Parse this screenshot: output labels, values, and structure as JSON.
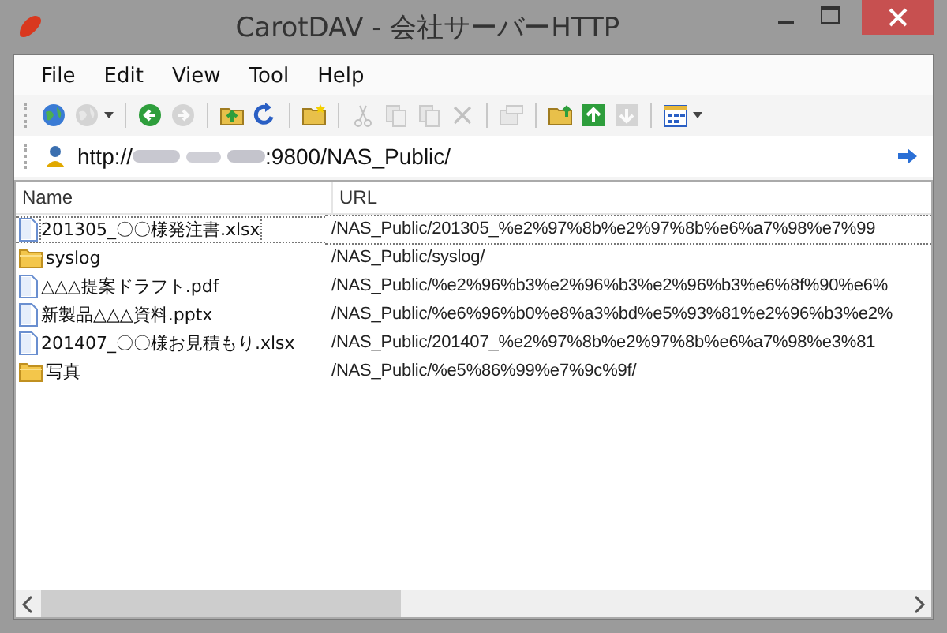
{
  "window": {
    "title": "CarotDAV - 会社サーバーHTTP"
  },
  "menu": [
    "File",
    "Edit",
    "View",
    "Tool",
    "Help"
  ],
  "toolbar": [
    {
      "disabled": false
    },
    {
      "disabled": true
    },
    {
      "disabled": false
    },
    {
      "disabled": true
    },
    {
      "disabled": false
    },
    {
      "disabled": false
    },
    {
      "disabled": false
    },
    {
      "disabled": true
    },
    {
      "disabled": true
    },
    {
      "disabled": true
    },
    {
      "disabled": true
    },
    {
      "disabled": true
    },
    {
      "disabled": false
    },
    {
      "disabled": false
    },
    {
      "disabled": true
    },
    {
      "disabled": false
    }
  ],
  "address": {
    "prefix": "http://",
    "suffix": ":9800/NAS_Public/"
  },
  "table": {
    "columns": [
      "Name",
      "URL"
    ],
    "rows": [
      {
        "kind": "file",
        "name": "201305_〇〇様発注書.xlsx",
        "url": "/NAS_Public/201305_%e2%97%8b%e2%97%8b%e6%a7%98%e7%99",
        "selected": true
      },
      {
        "kind": "folder",
        "name": "syslog",
        "url": "/NAS_Public/syslog/",
        "selected": false
      },
      {
        "kind": "file",
        "name": "△△△提案ドラフト.pdf",
        "url": "/NAS_Public/%e2%96%b3%e2%96%b3%e2%96%b3%e6%8f%90%e6%",
        "selected": false
      },
      {
        "kind": "file",
        "name": "新製品△△△資料.pptx",
        "url": "/NAS_Public/%e6%96%b0%e8%a3%bd%e5%93%81%e2%96%b3%e2%",
        "selected": false
      },
      {
        "kind": "file",
        "name": "201407_〇〇様お見積もり.xlsx",
        "url": "/NAS_Public/201407_%e2%97%8b%e2%97%8b%e6%a7%98%e3%81",
        "selected": false
      },
      {
        "kind": "folder",
        "name": "写真",
        "url": "/NAS_Public/%e5%86%99%e7%9c%9f/",
        "selected": false
      }
    ]
  }
}
